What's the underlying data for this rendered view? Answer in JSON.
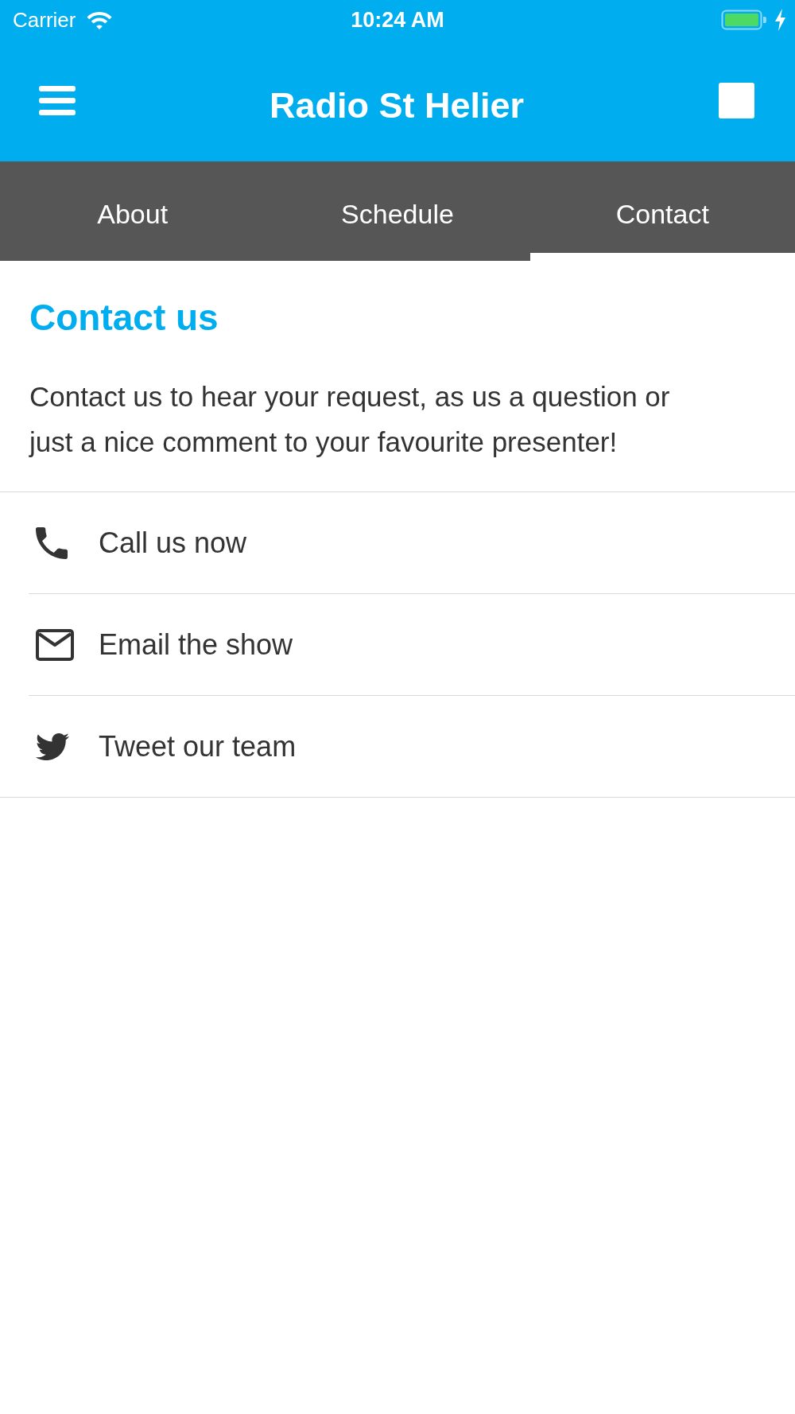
{
  "status_bar": {
    "carrier": "Carrier",
    "time": "10:24 AM"
  },
  "header": {
    "title": "Radio St Helier"
  },
  "tabs": [
    {
      "label": "About",
      "selected": false
    },
    {
      "label": "Schedule",
      "selected": false
    },
    {
      "label": "Contact",
      "selected": true
    }
  ],
  "contact_section": {
    "heading": "Contact us",
    "description": "Contact us to hear your request, as us a question or just a nice comment to your favourite presenter!"
  },
  "contact_options": [
    {
      "kind": "phone",
      "label": "Call us now"
    },
    {
      "kind": "email",
      "label": "Email the show"
    },
    {
      "kind": "twitter",
      "label": "Tweet our team"
    }
  ]
}
